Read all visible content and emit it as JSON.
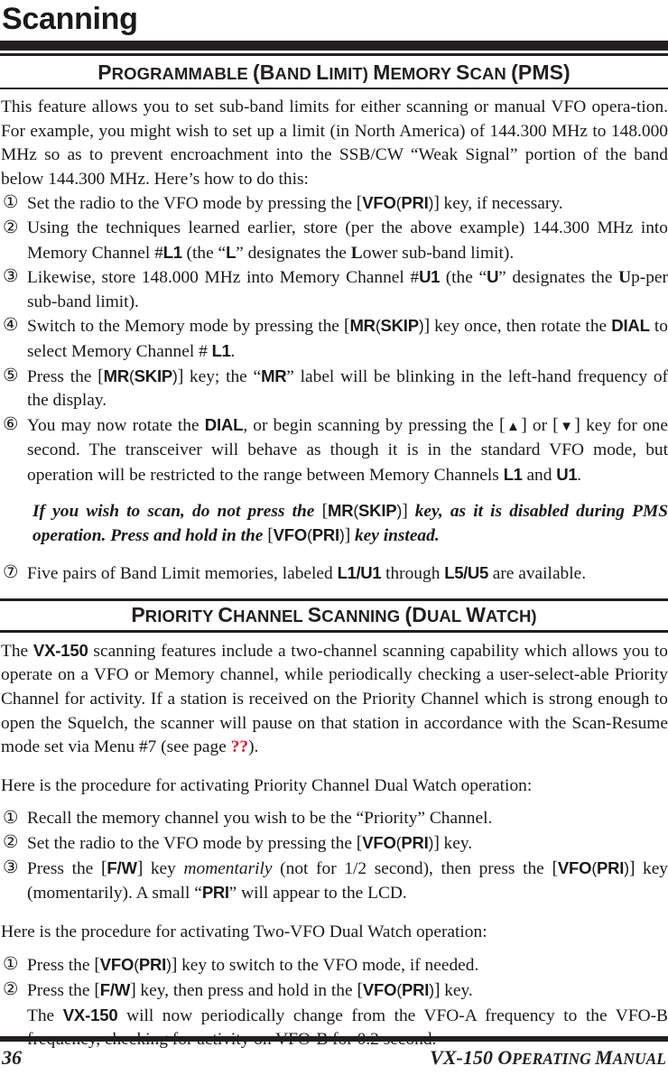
{
  "document": {
    "chapter_title": "Scanning",
    "page_number": "36",
    "footer_title_parts": [
      {
        "text": "VX-150 O",
        "size": "cap"
      },
      {
        "text": "PERATING ",
        "size": "sc"
      },
      {
        "text": "M",
        "size": "cap"
      },
      {
        "text": "ANUAL",
        "size": "sc"
      }
    ]
  },
  "sections": [
    {
      "id": "pms",
      "heading": "PROGRAMMABLE (BAND LIMIT) MEMORY SCAN (PMS)",
      "heading_parts": [
        {
          "text": "P",
          "size": "cap"
        },
        {
          "text": "ROGRAMMABLE ",
          "size": "sc"
        },
        {
          "text": "(B",
          "size": "cap"
        },
        {
          "text": "AND ",
          "size": "sc"
        },
        {
          "text": "L",
          "size": "cap"
        },
        {
          "text": "IMIT) ",
          "size": "sc"
        },
        {
          "text": "M",
          "size": "cap"
        },
        {
          "text": "EMORY ",
          "size": "sc"
        },
        {
          "text": "S",
          "size": "cap"
        },
        {
          "text": "CAN ",
          "size": "sc"
        },
        {
          "text": "(PMS)",
          "size": "cap"
        }
      ],
      "intro": "This feature allows you to set sub-band limits for either scanning or manual VFO operation. For example, you might wish to set up a limit (in North America) of 144.300 MHz to 148.000 MHz so as to prevent encroachment into the SSB/CW “Weak Signal” portion of the band below 144.300 MHz. Here’s how to do this:",
      "steps": [
        {
          "num": "①",
          "text": "Set the radio to the VFO mode by pressing the [VFO(PRI)] key, if necessary."
        },
        {
          "num": "②",
          "text": "Using the techniques learned earlier, store (per the above example) 144.300 MHz into Memory Channel #L1 (the “L” designates the Lower sub-band limit)."
        },
        {
          "num": "③",
          "text": "Likewise, store 148.000 MHz into Memory Channel #U1 (the “U” designates the Upper sub-band limit)."
        },
        {
          "num": "④",
          "text": "Switch to the Memory mode by pressing the [MR(SKIP)] key once, then rotate the DIAL to select Memory Channel # L1."
        },
        {
          "num": "⑤",
          "text": "Press the [MR(SKIP)] key; the “MR” label will be blinking in the left-hand frequency of the display."
        },
        {
          "num": "⑥",
          "text": "You may now rotate the DIAL, or begin scanning by pressing the [▲] or [▼] key for one second. The transceiver will behave as though it is in the standard VFO mode, but operation will be restricted to the range between Memory Channels L1 and U1."
        }
      ],
      "note": "If you wish to scan, do not press the [MR(SKIP)] key, as it is disabled during PMS operation. Press and hold in the [VFO(PRI)] key instead.",
      "final_step": {
        "num": "⑦",
        "text": "Five pairs of Band Limit memories, labeled L1/U1 through L5/U5 are available."
      }
    },
    {
      "id": "priority",
      "heading": "PRIORITY CHANNEL SCANNING (DUAL WATCH)",
      "heading_parts": [
        {
          "text": "P",
          "size": "cap"
        },
        {
          "text": "RIORITY ",
          "size": "sc"
        },
        {
          "text": "C",
          "size": "cap"
        },
        {
          "text": "HANNEL ",
          "size": "sc"
        },
        {
          "text": "S",
          "size": "cap"
        },
        {
          "text": "CANNING ",
          "size": "sc"
        },
        {
          "text": "(D",
          "size": "cap"
        },
        {
          "text": "UAL ",
          "size": "sc"
        },
        {
          "text": "W",
          "size": "cap"
        },
        {
          "text": "ATCH)",
          "size": "sc"
        }
      ],
      "intro": "The VX-150 scanning features include a two-channel scanning capability which allows you to operate on a VFO or Memory channel, while periodically checking a user-selectable Priority Channel for activity. If a station is received on the Priority Channel which is strong enough to open the Squelch, the scanner will pause on that station in accordance with the Scan-Resume mode set via Menu #7 (see page ??).",
      "cross_reference": "??",
      "cross_reference_color": "#e8192c",
      "procedure_1_lead": "Here is the procedure for activating Priority Channel Dual Watch operation:",
      "procedure_1_steps": [
        {
          "num": "①",
          "text": "Recall the memory channel you wish to be the “Priority” Channel."
        },
        {
          "num": "②",
          "text": "Set the radio to the VFO mode by pressing the [VFO(PRI)] key."
        },
        {
          "num": "③",
          "text": "Press the [F/W] key momentarily (not for 1/2 second), then press the [VFO(PRI)] key (momentarily). A small “PRI” will appear to the LCD."
        }
      ],
      "procedure_2_lead": "Here is the procedure for activating Two-VFO Dual Watch operation:",
      "procedure_2_steps": [
        {
          "num": "①",
          "text": "Press the [VFO(PRI)] key to switch to the VFO mode, if needed."
        },
        {
          "num": "②",
          "text": "Press the [F/W] key, then press and hold in the [VFO(PRI)] key. The VX-150 will now periodically change from the VFO-A frequency to the VFO-B frequency, checking for activity on VFO-B for 0.2 second."
        }
      ]
    }
  ],
  "keys": {
    "vfo_pri": "[VFO(PRI)]",
    "mr_skip": "[MR(SKIP)]",
    "fw": "[F/W]",
    "up_arrow": "[▲]",
    "down_arrow": "[▼]"
  },
  "labels": {
    "dial": "DIAL",
    "l1": "L1",
    "u1": "U1",
    "l5": "L5",
    "u5": "U5",
    "mr": "MR",
    "pri": "PRI",
    "model": "VX-150"
  }
}
